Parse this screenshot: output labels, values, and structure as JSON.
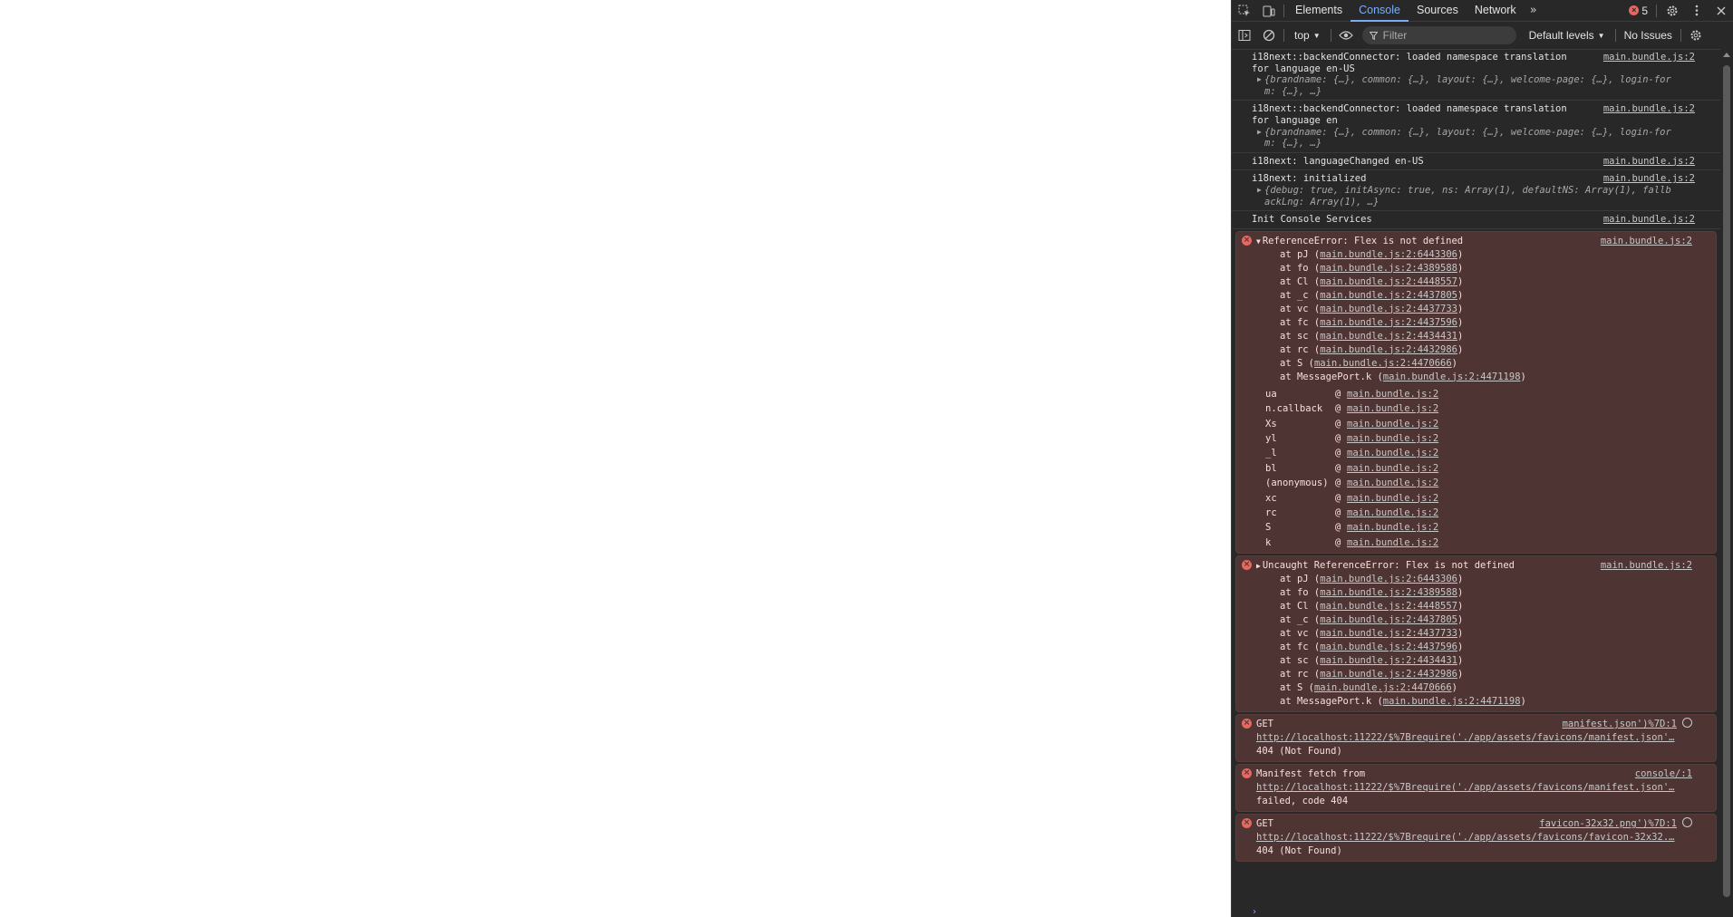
{
  "devtools": {
    "tabs": [
      "Elements",
      "Console",
      "Sources",
      "Network"
    ],
    "active_tab": "Console",
    "error_count": "5",
    "toolbar": {
      "context": "top",
      "filter_placeholder": "Filter",
      "levels": "Default levels",
      "issues": "No Issues"
    },
    "messages": [
      {
        "text": "i18next::backendConnector: loaded namespace translation\nfor language en-US",
        "source": "main.bundle.js:2",
        "obj_line1": "{brandname: {…}, common: {…}, layout: {…}, welcome-page: {…}, login-for",
        "obj_line2": "m: {…}, …}"
      },
      {
        "text": "i18next::backendConnector: loaded namespace translation\nfor language en",
        "source": "main.bundle.js:2",
        "obj_line1": "{brandname: {…}, common: {…}, layout: {…}, welcome-page: {…}, login-for",
        "obj_line2": "m: {…}, …}"
      },
      {
        "text": "i18next: languageChanged en-US",
        "source": "main.bundle.js:2"
      },
      {
        "text": "i18next: initialized",
        "source": "main.bundle.js:2",
        "obj_line1": "{debug: true, initAsync: true, ns: Array(1), defaultNS: Array(1), fallb",
        "obj_line2": "ackLng: Array(1), …}"
      },
      {
        "text": "Init Console Services",
        "source": "main.bundle.js:2"
      }
    ],
    "error1": {
      "head": "ReferenceError: Flex is not defined",
      "source": "main.bundle.js:2",
      "frames": [
        {
          "fn": "at pJ (",
          "link": "main.bundle.js:2:6443306",
          "end": ")"
        },
        {
          "fn": "at fo (",
          "link": "main.bundle.js:2:4389588",
          "end": ")"
        },
        {
          "fn": "at Cl (",
          "link": "main.bundle.js:2:4448557",
          "end": ")"
        },
        {
          "fn": "at _c (",
          "link": "main.bundle.js:2:4437805",
          "end": ")"
        },
        {
          "fn": "at vc (",
          "link": "main.bundle.js:2:4437733",
          "end": ")"
        },
        {
          "fn": "at fc (",
          "link": "main.bundle.js:2:4437596",
          "end": ")"
        },
        {
          "fn": "at sc (",
          "link": "main.bundle.js:2:4434431",
          "end": ")"
        },
        {
          "fn": "at rc (",
          "link": "main.bundle.js:2:4432986",
          "end": ")"
        },
        {
          "fn": "at S (",
          "link": "main.bundle.js:2:4470666",
          "end": ")"
        },
        {
          "fn": "at MessagePort.k (",
          "link": "main.bundle.js:2:4471198",
          "end": ")"
        }
      ],
      "stack": [
        {
          "fn": "ua",
          "at": "@",
          "link": "main.bundle.js:2"
        },
        {
          "fn": "n.callback",
          "at": "@",
          "link": "main.bundle.js:2"
        },
        {
          "fn": "Xs",
          "at": "@",
          "link": "main.bundle.js:2"
        },
        {
          "fn": "yl",
          "at": "@",
          "link": "main.bundle.js:2"
        },
        {
          "fn": "_l",
          "at": "@",
          "link": "main.bundle.js:2"
        },
        {
          "fn": "bl",
          "at": "@",
          "link": "main.bundle.js:2"
        },
        {
          "fn": "(anonymous)",
          "at": "@",
          "link": "main.bundle.js:2"
        },
        {
          "fn": "xc",
          "at": "@",
          "link": "main.bundle.js:2"
        },
        {
          "fn": "rc",
          "at": "@",
          "link": "main.bundle.js:2"
        },
        {
          "fn": "S",
          "at": "@",
          "link": "main.bundle.js:2"
        },
        {
          "fn": "k",
          "at": "@",
          "link": "main.bundle.js:2"
        }
      ]
    },
    "error2": {
      "head": "Uncaught ReferenceError: Flex is not defined",
      "source": "main.bundle.js:2",
      "frames": [
        {
          "fn": "at pJ (",
          "link": "main.bundle.js:2:6443306",
          "end": ")"
        },
        {
          "fn": "at fo (",
          "link": "main.bundle.js:2:4389588",
          "end": ")"
        },
        {
          "fn": "at Cl (",
          "link": "main.bundle.js:2:4448557",
          "end": ")"
        },
        {
          "fn": "at _c (",
          "link": "main.bundle.js:2:4437805",
          "end": ")"
        },
        {
          "fn": "at vc (",
          "link": "main.bundle.js:2:4437733",
          "end": ")"
        },
        {
          "fn": "at fc (",
          "link": "main.bundle.js:2:4437596",
          "end": ")"
        },
        {
          "fn": "at sc (",
          "link": "main.bundle.js:2:4434431",
          "end": ")"
        },
        {
          "fn": "at rc (",
          "link": "main.bundle.js:2:4432986",
          "end": ")"
        },
        {
          "fn": "at S (",
          "link": "main.bundle.js:2:4470666",
          "end": ")"
        },
        {
          "fn": "at MessagePort.k (",
          "link": "main.bundle.js:2:4471198",
          "end": ")"
        }
      ]
    },
    "error3": {
      "line1": "GET",
      "url": "http://localhost:11222/$%7Brequire('./app/assets/favicons/manifest.json'…",
      "line3": "404 (Not Found)",
      "source": "manifest.json')%7D:1"
    },
    "error4": {
      "line1": "Manifest fetch from",
      "url": "http://localhost:11222/$%7Brequire('./app/assets/favicons/manifest.json'…",
      "line3": "failed, code 404",
      "source": "console/:1"
    },
    "error5": {
      "line1": "GET",
      "url": "http://localhost:11222/$%7Brequire('./app/assets/favicons/favicon-32x32.…",
      "line3": "404 (Not Found)",
      "source": "favicon-32x32.png')%7D:1"
    }
  }
}
